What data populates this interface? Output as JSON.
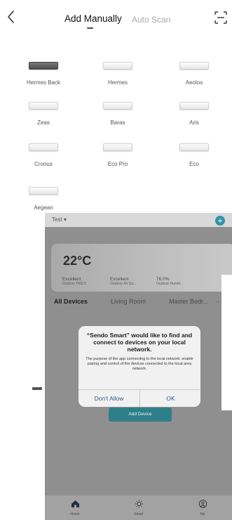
{
  "header": {
    "back_icon": "chevron-left-icon",
    "tab_active": "Add Manually",
    "tab_inactive": "Auto Scan",
    "scan_icon": "scan-icon"
  },
  "models": [
    {
      "name": "Hermes Back",
      "style": "dark"
    },
    {
      "name": "Hermes",
      "style": "light"
    },
    {
      "name": "Aeolos",
      "style": "light"
    },
    {
      "name": "Zeas",
      "style": "light"
    },
    {
      "name": "Baras",
      "style": "light"
    },
    {
      "name": "Aris",
      "style": "light"
    },
    {
      "name": "Cronus",
      "style": "light"
    },
    {
      "name": "Eco Pro",
      "style": "light"
    },
    {
      "name": "Eco",
      "style": "light"
    },
    {
      "name": "Aegean",
      "style": "light"
    }
  ],
  "phone": {
    "home_name": "Test ▾",
    "add_icon": "plus-icon",
    "temperature": "22°C",
    "stats": [
      {
        "value": "Excellent",
        "label": "Outdoor PM2.5"
      },
      {
        "value": "Excellent",
        "label": "Outdoor Air Qu..."
      },
      {
        "value": "76.0%",
        "label": "Outdoor Humid..."
      }
    ],
    "room_tabs": [
      "All Devices",
      "Living Room",
      "Master Bedr...",
      "···"
    ],
    "dialog": {
      "title": "“Sendo Smart” would like to find and connect to devices on your local network.",
      "message": "The purpose of the app connecting to the local network: enable pairing and control of the devices connected to the local area network.",
      "deny": "Don't Allow",
      "allow": "OK"
    },
    "add_device": "Add Device",
    "nav": [
      {
        "label": "Home",
        "icon": "home-icon"
      },
      {
        "label": "Smart",
        "icon": "sun-icon"
      },
      {
        "label": "Me",
        "icon": "profile-icon"
      }
    ]
  },
  "colors": {
    "accent": "#2f95a4",
    "dialog_button": "#2a5c8a"
  }
}
